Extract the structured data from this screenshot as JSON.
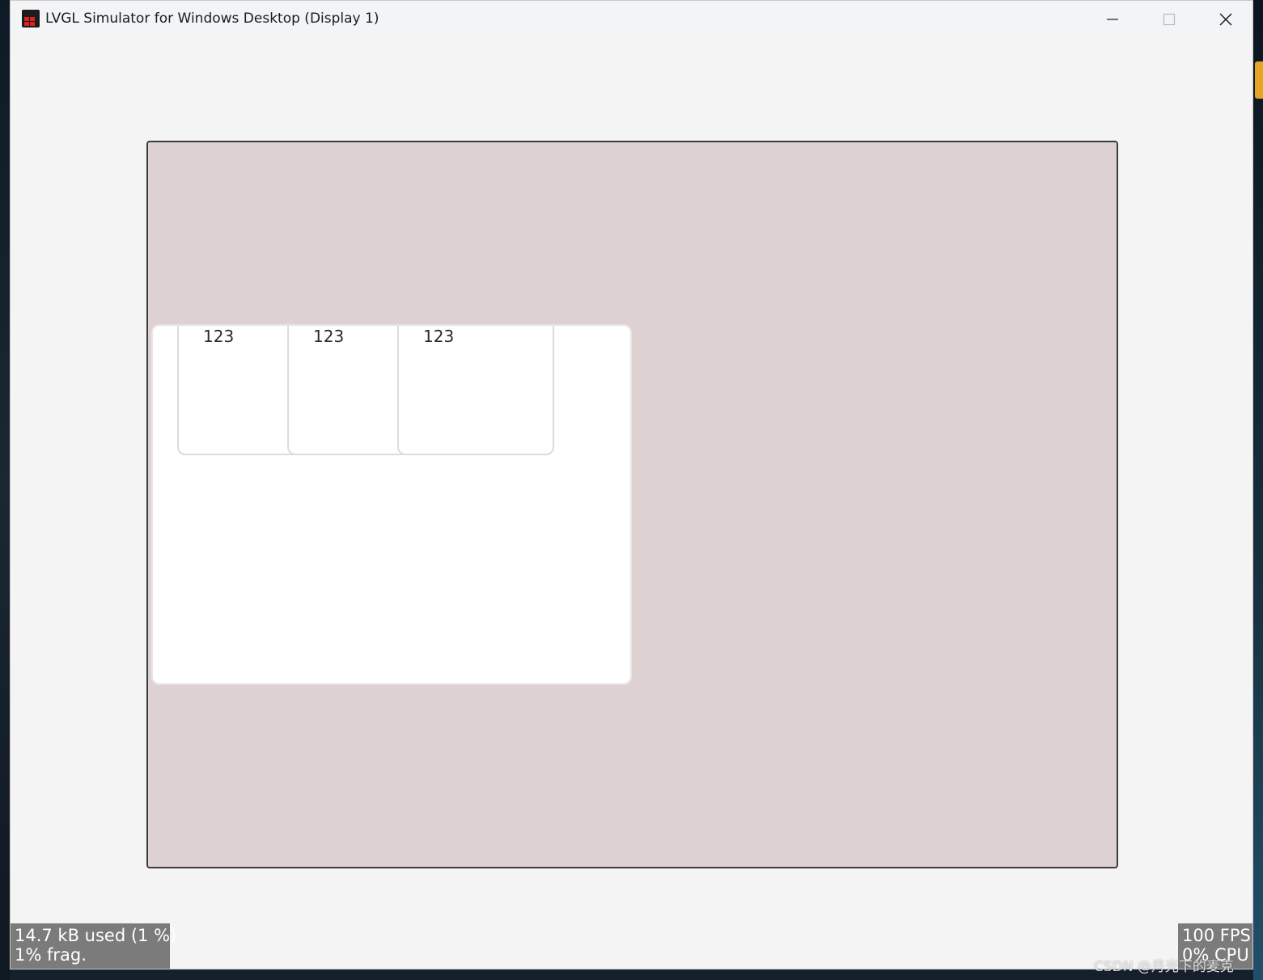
{
  "window": {
    "title": "LVGL Simulator for Windows Desktop (Display 1)",
    "icon": "lvgl-app-icon",
    "controls": {
      "minimize_icon": "minimize-icon",
      "maximize_icon": "maximize-icon",
      "close_icon": "close-icon"
    }
  },
  "screen": {
    "background_color": "#ddd1d2",
    "panel": {
      "background_color": "#ffffff",
      "tiles": [
        {
          "label": "123"
        },
        {
          "label": "123"
        },
        {
          "label": "123"
        }
      ]
    }
  },
  "monitors": {
    "memory": {
      "line1": "14.7 kB used (1 %)",
      "line2": "1% frag."
    },
    "performance": {
      "line1": "100 FPS",
      "line2": "0% CPU"
    }
  },
  "watermark": "CSDN @月光下的麦克"
}
